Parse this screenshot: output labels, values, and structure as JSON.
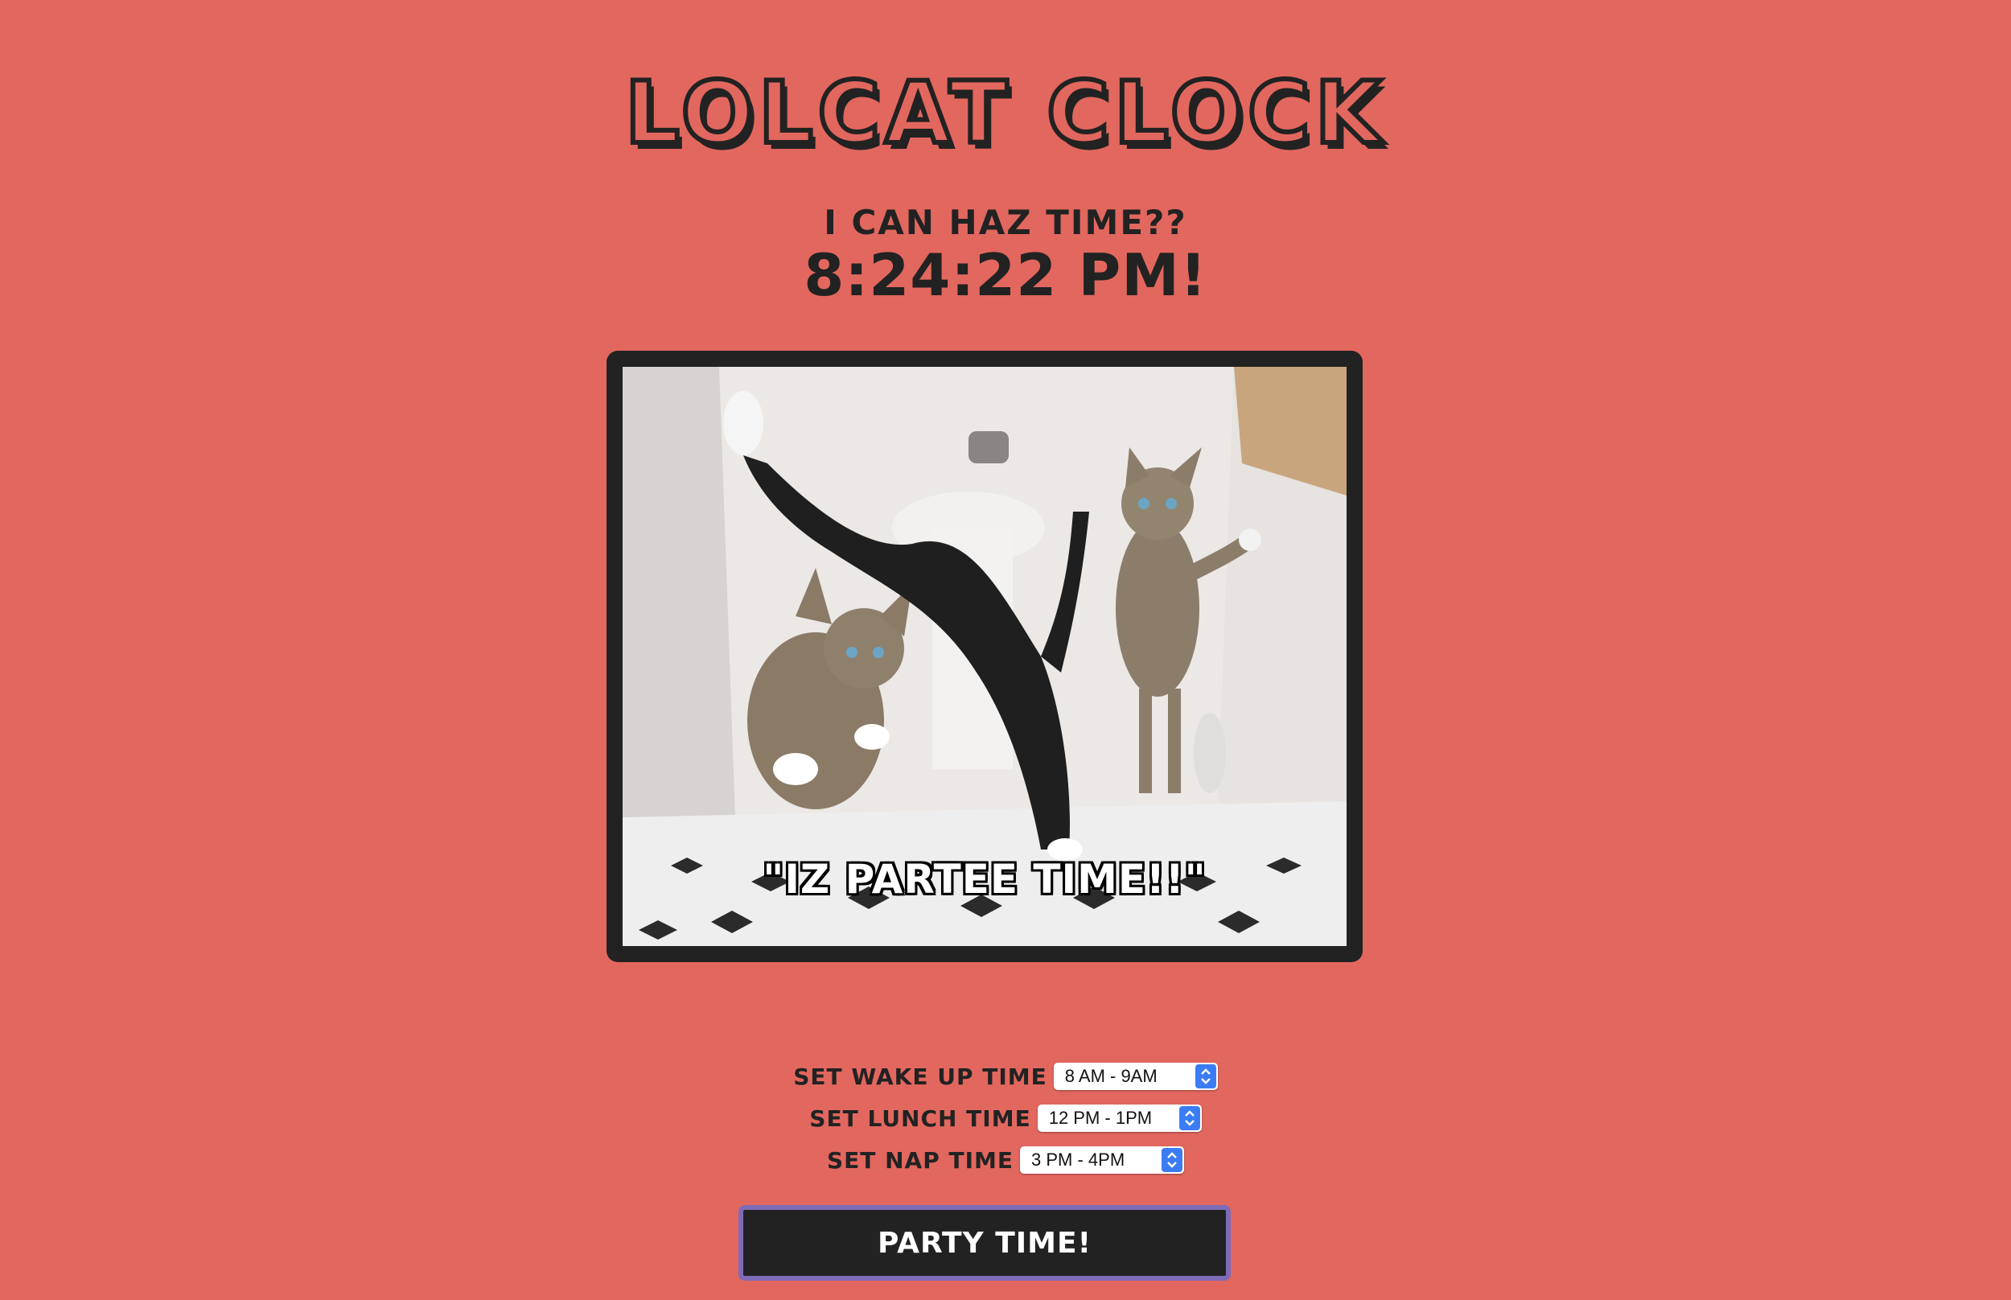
{
  "header": {
    "title": "LOLCAT CLOCK",
    "subtitle": "I CAN HAZ TIME??",
    "clock": "8:24:22 PM!"
  },
  "image": {
    "caption": "\"IZ PARTEE TIME!!\""
  },
  "controls": {
    "wake": {
      "label": "SET WAKE UP TIME",
      "value": "8 AM - 9AM"
    },
    "lunch": {
      "label": "SET LUNCH TIME",
      "value": "12 PM - 1PM"
    },
    "nap": {
      "label": "SET NAP TIME",
      "value": "3 PM - 4PM"
    }
  },
  "party_button": "PARTY TIME!",
  "colors": {
    "background": "#e2675e",
    "dark": "#222222",
    "button_border": "#7d6bb8",
    "select_accent": "#3b7cf5"
  }
}
